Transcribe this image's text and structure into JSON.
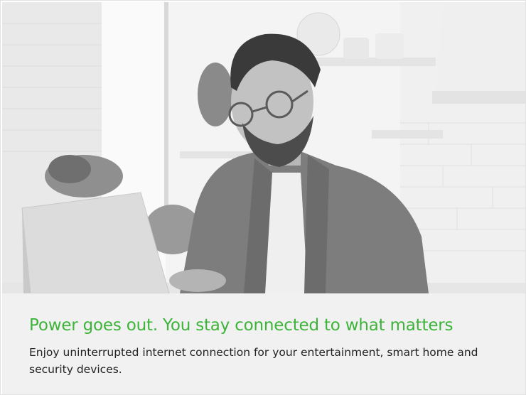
{
  "banner": {
    "headline": "Power goes out. You stay connected to what matters",
    "body": "Enjoy uninterrupted internet connection for your entertainment, smart home and security devices."
  },
  "colors": {
    "headline": "#3db33a",
    "body_text": "#222222",
    "caption_background": "#f1f1f1"
  },
  "photo": {
    "icon": "man-with-laptop-photo"
  }
}
